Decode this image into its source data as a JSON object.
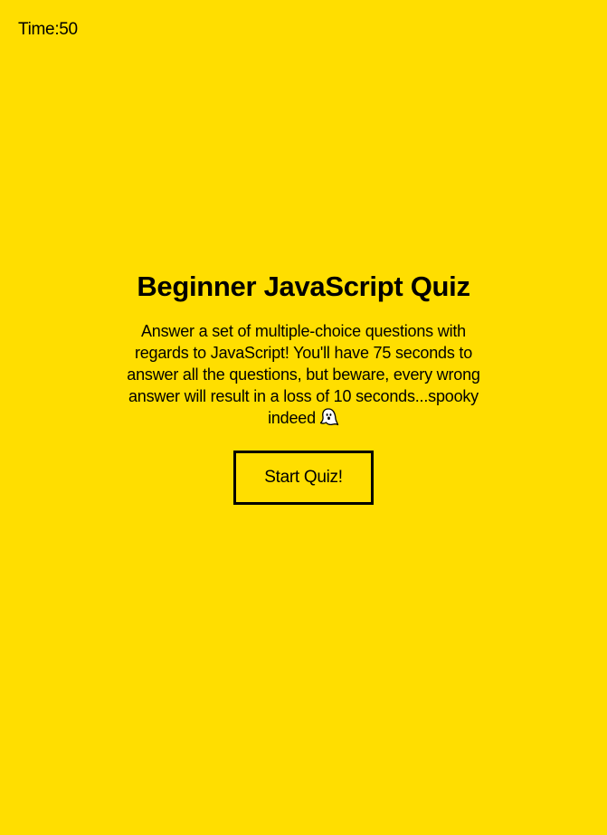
{
  "timer": {
    "label": "Time:50"
  },
  "quiz": {
    "title": "Beginner JavaScript Quiz",
    "description": "Answer a set of multiple-choice questions with regards to JavaScript! You'll have 75 seconds to answer all the questions, but beware, every wrong answer will result in a loss of 10 seconds...spooky indeed",
    "description_icon": "ghost-icon",
    "start_button_label": "Start Quiz!"
  },
  "colors": {
    "background": "#FFDE00",
    "text": "#000000"
  }
}
